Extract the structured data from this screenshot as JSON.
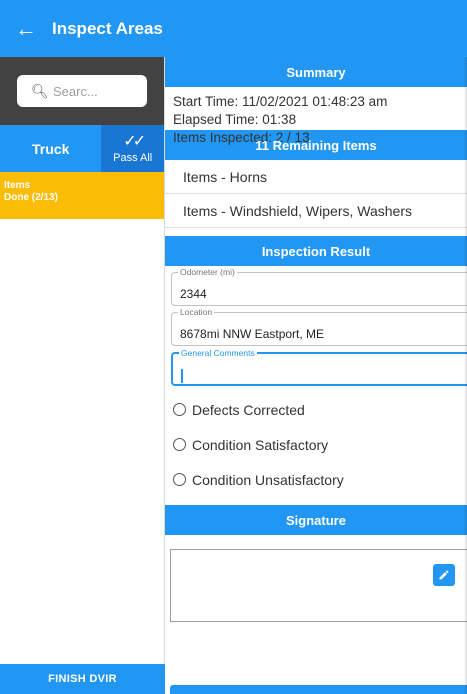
{
  "header": {
    "back_icon": "arrow-left-icon",
    "title": "Inspect Areas"
  },
  "sidebar": {
    "search_placeholder": "Searc...",
    "tab_truck": "Truck",
    "pass_all_label": "Pass All",
    "category": {
      "title": "Items",
      "status": "Done (2/13)"
    },
    "finish_label": "FINISH DVIR"
  },
  "summary": {
    "heading": "Summary",
    "start_time": "Start Time: 11/02/2021 01:48:23 am",
    "elapsed_time": "Elapsed Time: 01:38",
    "items_inspected": "Items Inspected: 2 / 13"
  },
  "remaining": {
    "heading": "11 Remaining Items",
    "items": [
      "Items - Horns",
      "Items - Windshield, Wipers, Washers"
    ]
  },
  "result": {
    "heading": "Inspection Result",
    "odometer_label": "Odometer (mi)",
    "odometer_value": "2344",
    "location_label": "Location",
    "location_value": "8678mi NNW Eastport, ME",
    "comments_label": "General Comments",
    "options": [
      "Defects Corrected",
      "Condition Satisfactory",
      "Condition Unsatisfactory"
    ]
  },
  "signature": {
    "heading": "Signature"
  },
  "colors": {
    "primary": "#2196f3",
    "accent_yellow": "#fbbc05",
    "dark": "#424242"
  }
}
